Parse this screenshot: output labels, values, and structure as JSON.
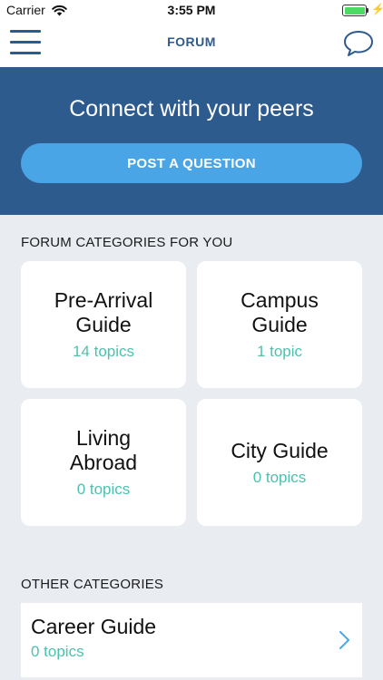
{
  "status_bar": {
    "carrier": "Carrier",
    "time": "3:55 PM",
    "battery_level": 1.0,
    "icons": [
      "wifi-icon",
      "battery-icon",
      "charging-bolt-icon"
    ]
  },
  "nav": {
    "title": "FORUM",
    "left_icon": "hamburger-menu-icon",
    "right_icon": "chat-bubble-icon"
  },
  "hero": {
    "title": "Connect with your peers",
    "button_label": "POST A QUESTION"
  },
  "sections": {
    "for_you_label": "FORUM CATEGORIES FOR YOU",
    "other_label": "OTHER CATEGORIES"
  },
  "categories": [
    {
      "title": "Pre-Arrival Guide",
      "count": "14 topics"
    },
    {
      "title": "Campus Guide",
      "count": "1 topic"
    },
    {
      "title": "Living Abroad",
      "count": "0 topics"
    },
    {
      "title": "City Guide",
      "count": "0 topics"
    }
  ],
  "other_categories": [
    {
      "title": "Career Guide",
      "count": "0 topics",
      "icon": "chevron-right-icon"
    }
  ],
  "colors": {
    "brand_blue": "#2e5b8e",
    "button_blue": "#4aa5e6",
    "topic_teal": "#4cc1ae",
    "background": "#e9edf1"
  }
}
